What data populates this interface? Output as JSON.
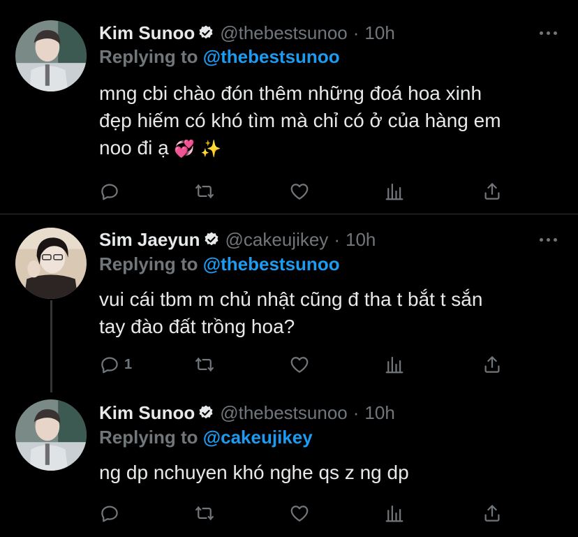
{
  "tweets": [
    {
      "name": "Kim Sunoo",
      "handle": "@thebestsunoo",
      "time": "10h",
      "replying_prefix": "Replying to ",
      "replying_to": "@thebestsunoo",
      "text_line1": "mng cbi chào đón thêm những đoá hoa xinh",
      "text_line2": "đẹp hiếm có khó tìm mà chỉ có ở của hàng em",
      "text_line3": "noo đi ạ",
      "emoji1": "💞",
      "emoji2": "✨",
      "reply_count": ""
    },
    {
      "name": "Sim Jaeyun",
      "handle": "@cakeujikey",
      "time": "10h",
      "replying_prefix": "Replying to ",
      "replying_to": "@thebestsunoo",
      "text_line1": "vui cái tbm m chủ nhật cũng đ tha t bắt t sắn",
      "text_line2": "tay đào đất trồng hoa?",
      "reply_count": "1"
    },
    {
      "name": "Kim Sunoo",
      "handle": "@thebestsunoo",
      "time": "10h",
      "replying_prefix": "Replying to ",
      "replying_to": "@cakeujikey",
      "text_line1": "ng dp nchuyen khó nghe qs z ng dp",
      "reply_count": ""
    }
  ],
  "separator": "·",
  "colors": {
    "background": "#000000",
    "text": "#e7e9ea",
    "muted": "#71767b",
    "link": "#1d9bf0",
    "divider": "#2f3336"
  },
  "icons": [
    "reply-icon",
    "retweet-icon",
    "like-icon",
    "analytics-icon",
    "share-icon",
    "verified-badge-icon",
    "more-icon"
  ]
}
